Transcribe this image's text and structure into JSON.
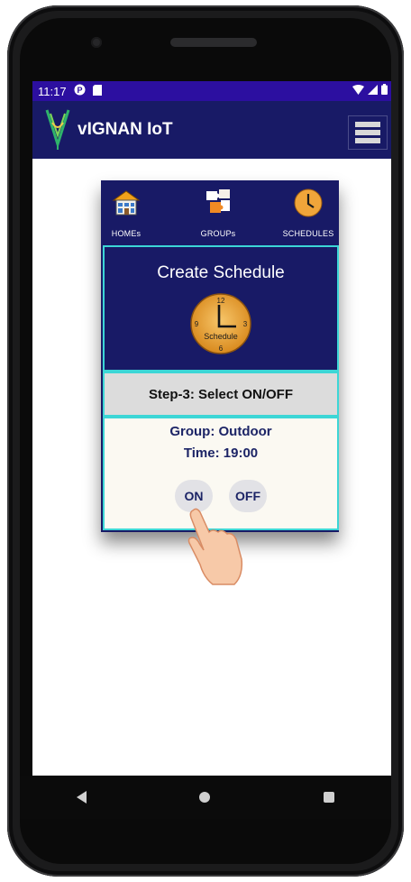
{
  "status_bar": {
    "time": "11:17"
  },
  "app_bar": {
    "title": "vIGNAN IoT"
  },
  "tabs": [
    {
      "label": "HOMEs",
      "icon": "house-icon"
    },
    {
      "label": "GROUPs",
      "icon": "puzzle-icon"
    },
    {
      "label": "SCHEDULES",
      "icon": "clock-icon"
    }
  ],
  "schedule": {
    "title": "Create Schedule",
    "clock_label": "Schedule",
    "clock_numbers": [
      "12",
      "3",
      "6",
      "9"
    ],
    "step_label": "Step-3: Select ON/OFF",
    "group_text": "Group: Outdoor",
    "time_text": "Time: 19:00",
    "on_label": "ON",
    "off_label": "OFF"
  },
  "colors": {
    "status_bar": "#2c0fa0",
    "app_bar": "#181a66",
    "accent_border": "#3cd6d6"
  }
}
